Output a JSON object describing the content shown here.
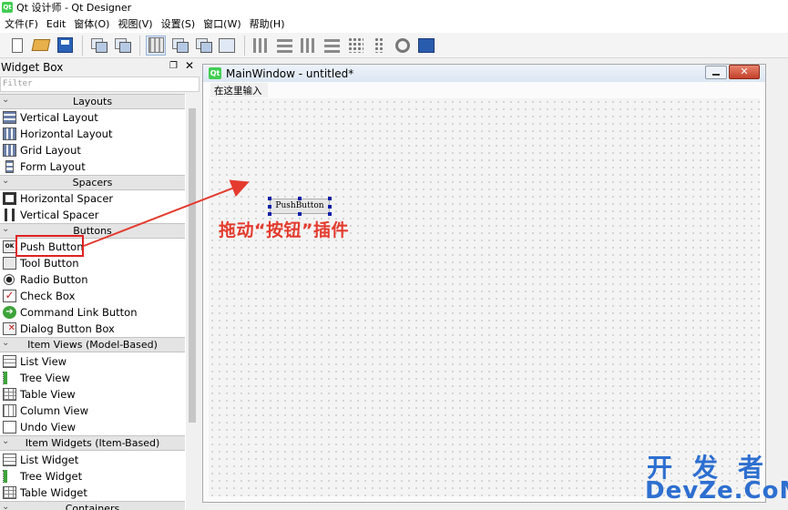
{
  "app": {
    "title": "Qt 设计师 - Qt Designer",
    "icon_label": "Qt"
  },
  "menu": [
    "文件(F)",
    "Edit",
    "窗体(O)",
    "视图(V)",
    "设置(S)",
    "窗口(W)",
    "帮助(H)"
  ],
  "toolbar_icons": [
    "new-form-icon",
    "open-icon",
    "save-icon",
    "send-to-back-icon",
    "bring-to-front-icon",
    "edit-widgets-icon",
    "edit-signals-slots-icon",
    "edit-buddies-icon",
    "edit-tab-order-icon",
    "lay-out-horizontally-icon",
    "lay-out-vertically-icon",
    "lay-out-horizontal-splitter-icon",
    "lay-out-vertical-splitter-icon",
    "lay-out-grid-icon",
    "lay-out-form-icon",
    "break-layout-icon",
    "adjust-size-icon"
  ],
  "widget_box": {
    "title": "Widget Box",
    "filter_placeholder": "Filter",
    "categories": [
      {
        "name": "Layouts",
        "items": [
          "Vertical Layout",
          "Horizontal Layout",
          "Grid Layout",
          "Form Layout"
        ]
      },
      {
        "name": "Spacers",
        "items": [
          "Horizontal Spacer",
          "Vertical Spacer"
        ]
      },
      {
        "name": "Buttons",
        "items": [
          "Push Button",
          "Tool Button",
          "Radio Button",
          "Check Box",
          "Command Link Button",
          "Dialog Button Box"
        ]
      },
      {
        "name": "Item Views (Model-Based)",
        "items": [
          "List View",
          "Tree View",
          "Table View",
          "Column View",
          "Undo View"
        ]
      },
      {
        "name": "Item Widgets (Item-Based)",
        "items": [
          "List Widget",
          "Tree Widget",
          "Table Widget"
        ]
      },
      {
        "name": "Containers",
        "items": []
      }
    ]
  },
  "main_window": {
    "title": "MainWindow - untitled*",
    "icon_label": "Qt",
    "menu_placeholder": "在这里输入",
    "close_glyph": "✕",
    "push_button_text": "PushButton"
  },
  "annotation": {
    "text": "拖动“按钮”插件",
    "color": "#e43b2e"
  },
  "watermark": {
    "line1": "开发者",
    "line2": "DevZe.CoM",
    "color": "#2d6fd0"
  },
  "pb_icon_text": "OK"
}
